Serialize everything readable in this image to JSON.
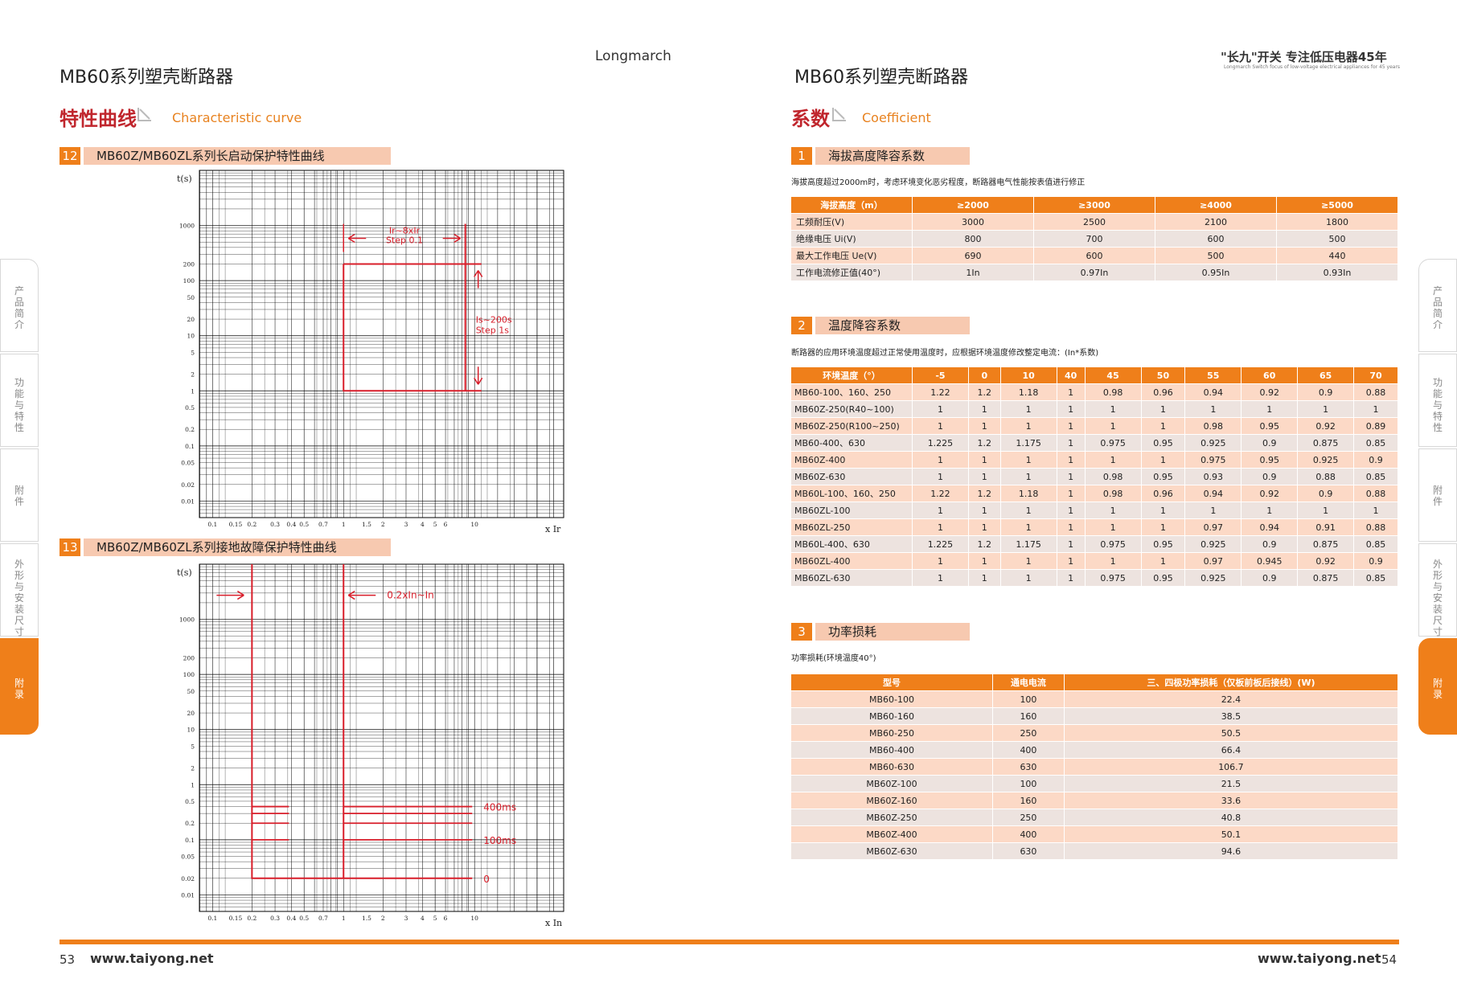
{
  "left": {
    "series_title": "MB60系列塑壳断路器",
    "brand": "Longmarch",
    "section_cn": "特性曲线",
    "section_en": "Characteristic curve",
    "chart12": {
      "num": "12",
      "title": "MB60Z/MB60ZL系列长启动保护特性曲线"
    },
    "chart13": {
      "num": "13",
      "title": "MB60Z/MB60ZL系列接地故障保护特性曲线"
    },
    "page_number": "53",
    "url": "www.taiyong.net"
  },
  "right": {
    "series_title": "MB60系列塑壳断路器",
    "slogan": "\"长九\"开关 专注低压电器45年",
    "slogan_en": "Longmarch Switch focus of low-voltage electrical appliances for 45 years",
    "section_cn": "系数",
    "section_en": "Coefficient",
    "page_number": "54",
    "url": "www.taiyong.net",
    "sec1": {
      "num": "1",
      "title": "海拔高度降容系数",
      "note": "海拔高度超过2000m时，考虑环境变化恶劣程度，断路器电气性能按表值进行修正",
      "header": [
        "海拔高度（m）",
        "≥2000",
        "≥3000",
        "≥4000",
        "≥5000"
      ],
      "rows": [
        [
          "工频耐压(V)",
          "3000",
          "2500",
          "2100",
          "1800"
        ],
        [
          "绝缘电压 Ui(V)",
          "800",
          "700",
          "600",
          "500"
        ],
        [
          "最大工作电压 Ue(V)",
          "690",
          "600",
          "500",
          "440"
        ],
        [
          "工作电流修正值(40°)",
          "1In",
          "0.97In",
          "0.95In",
          "0.93In"
        ]
      ]
    },
    "sec2": {
      "num": "2",
      "title": "温度降容系数",
      "note": "断路器的应用环境温度超过正常使用温度时，应根据环境温度修改整定电流：(In*系数)",
      "header": [
        "环境温度（°）",
        "-5",
        "0",
        "10",
        "40",
        "45",
        "50",
        "55",
        "60",
        "65",
        "70"
      ],
      "rows": [
        [
          "MB60-100、160、250",
          "1.22",
          "1.2",
          "1.18",
          "1",
          "0.98",
          "0.96",
          "0.94",
          "0.92",
          "0.9",
          "0.88"
        ],
        [
          "MB60Z-250(R40~100)",
          "1",
          "1",
          "1",
          "1",
          "1",
          "1",
          "1",
          "1",
          "1",
          "1"
        ],
        [
          "MB60Z-250(R100~250)",
          "1",
          "1",
          "1",
          "1",
          "1",
          "1",
          "0.98",
          "0.95",
          "0.92",
          "0.89"
        ],
        [
          "MB60-400、630",
          "1.225",
          "1.2",
          "1.175",
          "1",
          "0.975",
          "0.95",
          "0.925",
          "0.9",
          "0.875",
          "0.85"
        ],
        [
          "MB60Z-400",
          "1",
          "1",
          "1",
          "1",
          "1",
          "1",
          "0.975",
          "0.95",
          "0.925",
          "0.9"
        ],
        [
          "MB60Z-630",
          "1",
          "1",
          "1",
          "1",
          "0.98",
          "0.95",
          "0.93",
          "0.9",
          "0.88",
          "0.85"
        ],
        [
          "MB60L-100、160、250",
          "1.22",
          "1.2",
          "1.18",
          "1",
          "0.98",
          "0.96",
          "0.94",
          "0.92",
          "0.9",
          "0.88"
        ],
        [
          "MB60ZL-100",
          "1",
          "1",
          "1",
          "1",
          "1",
          "1",
          "1",
          "1",
          "1",
          "1"
        ],
        [
          "MB60ZL-250",
          "1",
          "1",
          "1",
          "1",
          "1",
          "1",
          "0.97",
          "0.94",
          "0.91",
          "0.88"
        ],
        [
          "MB60L-400、630",
          "1.225",
          "1.2",
          "1.175",
          "1",
          "0.975",
          "0.95",
          "0.925",
          "0.9",
          "0.875",
          "0.85"
        ],
        [
          "MB60ZL-400",
          "1",
          "1",
          "1",
          "1",
          "1",
          "1",
          "0.97",
          "0.945",
          "0.92",
          "0.9"
        ],
        [
          "MB60ZL-630",
          "1",
          "1",
          "1",
          "1",
          "0.975",
          "0.95",
          "0.925",
          "0.9",
          "0.875",
          "0.85"
        ]
      ]
    },
    "sec3": {
      "num": "3",
      "title": "功率损耗",
      "note": "功率损耗(环境温度40°)",
      "header": [
        "型号",
        "通电电流",
        "三、四极功率损耗（仅板前板后接线）(W)"
      ],
      "rows": [
        [
          "MB60-100",
          "100",
          "22.4"
        ],
        [
          "MB60-160",
          "160",
          "38.5"
        ],
        [
          "MB60-250",
          "250",
          "50.5"
        ],
        [
          "MB60-400",
          "400",
          "66.4"
        ],
        [
          "MB60-630",
          "630",
          "106.7"
        ],
        [
          "MB60Z-100",
          "100",
          "21.5"
        ],
        [
          "MB60Z-160",
          "160",
          "33.6"
        ],
        [
          "MB60Z-250",
          "250",
          "40.8"
        ],
        [
          "MB60Z-400",
          "400",
          "50.1"
        ],
        [
          "MB60Z-630",
          "630",
          "94.6"
        ]
      ]
    }
  },
  "side_tabs": [
    "产品简介",
    "功能与特性",
    "附件",
    "外形与安装尺寸",
    "附录"
  ],
  "active_tab": "附录",
  "colors": {
    "accent": "#ef7f1a",
    "light": "#f7c9b0",
    "curve": "#d81e2a",
    "title_red": "#c0262d"
  },
  "chart_data": [
    {
      "type": "line",
      "xlabel": "x Ir",
      "ylabel": "t(s)",
      "x_ticks": [
        "0.1",
        "0.15",
        "0.2",
        "0.3",
        "0.4",
        "0.5",
        "0.7",
        "1",
        "1.5",
        "2",
        "3",
        "4",
        "5",
        "6",
        "10"
      ],
      "y_ticks": [
        "1000",
        "200",
        "100",
        "50",
        "20",
        "10",
        "5",
        "2",
        "1",
        "0.5",
        "0.2",
        "0.1",
        "0.05",
        "0.02",
        "0.01"
      ],
      "annotations": [
        "Ir~8xIr\nStep 0.1",
        "Is~200s\nStep 1s"
      ],
      "annot1_lines": [
        "Ir~8xIr",
        "Step 0.1"
      ],
      "annot2_lines": [
        "Is~200s",
        "Step 1s"
      ]
    },
    {
      "type": "line",
      "xlabel": "x In",
      "ylabel": "t(s)",
      "x_ticks": [
        "0.1",
        "0.15",
        "0.2",
        "0.3",
        "0.4",
        "0.5",
        "0.7",
        "1",
        "1.5",
        "2",
        "3",
        "4",
        "5",
        "6",
        "10"
      ],
      "y_ticks": [
        "1000",
        "200",
        "100",
        "50",
        "20",
        "10",
        "5",
        "2",
        "1",
        "0.5",
        "0.2",
        "0.1",
        "0.05",
        "0.02",
        "0.01"
      ],
      "annotations": [
        "0.2xIn~In",
        "400ms",
        "100ms",
        "0"
      ]
    }
  ]
}
